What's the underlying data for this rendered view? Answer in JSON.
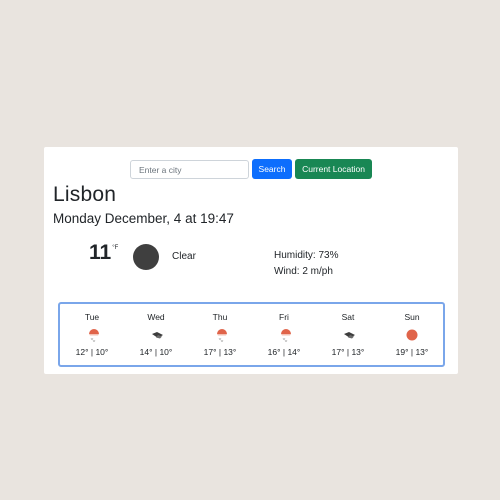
{
  "search": {
    "placeholder": "Enter a city",
    "search_label": "Search",
    "location_label": "Current Location"
  },
  "current": {
    "city": "Lisbon",
    "datetime": "Monday December, 4 at 19:47",
    "temperature": "11",
    "unit": "°F",
    "condition": "Clear",
    "condition_icon": "dark-circle-icon",
    "humidity": "Humidity: 73%",
    "wind": "Wind: 2 m/ph"
  },
  "forecast": [
    {
      "day": "Tue",
      "temps": "12° | 10°",
      "icon": "rain-icon"
    },
    {
      "day": "Wed",
      "temps": "14° | 10°",
      "icon": "cloud-icon"
    },
    {
      "day": "Thu",
      "temps": "17° | 13°",
      "icon": "rain-icon"
    },
    {
      "day": "Fri",
      "temps": "16° | 14°",
      "icon": "rain-icon"
    },
    {
      "day": "Sat",
      "temps": "17° | 13°",
      "icon": "cloud-icon"
    },
    {
      "day": "Sun",
      "temps": "19° | 13°",
      "icon": "sun-icon"
    }
  ],
  "colors": {
    "background": "#e9e4df",
    "search_button": "#0d6efd",
    "location_button": "#198754",
    "forecast_border": "#7aa6ea",
    "sun": "#e0644a"
  }
}
